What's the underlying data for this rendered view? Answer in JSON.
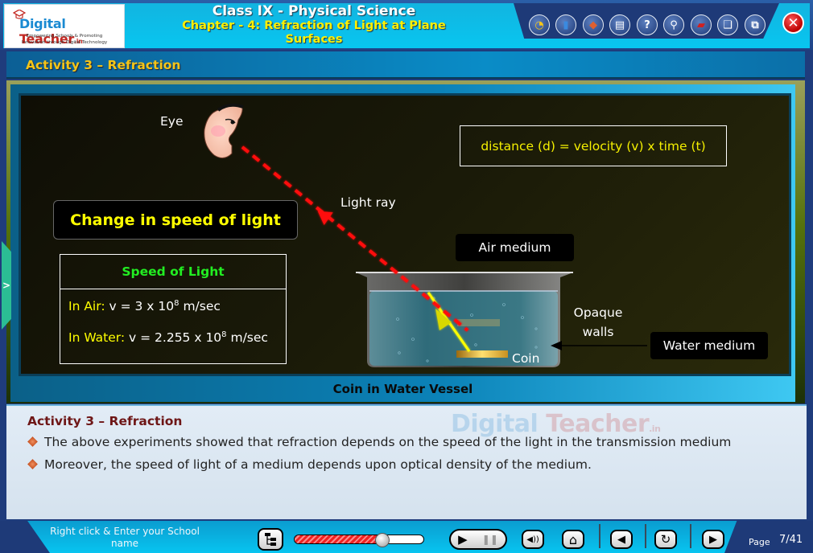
{
  "header": {
    "logo": {
      "brand_primary": "Digital",
      "brand_secondary": "Teacher",
      "brand_suffix": ".in",
      "tagline_line1": "Empowering Schools & Promoting",
      "tagline_line2": "Innovation through Digital Technology"
    },
    "title": "Class IX - Physical Science",
    "subtitle": "Chapter - 4: Refraction of Light at Plane Surfaces",
    "toolbar": [
      {
        "icon": "dashboard-folder-icon",
        "glyph": "◔"
      },
      {
        "icon": "reference-book-icon",
        "glyph": "▮"
      },
      {
        "icon": "drawing-board-icon",
        "glyph": "◆"
      },
      {
        "icon": "notepad-icon",
        "glyph": "▤"
      },
      {
        "icon": "help-icon",
        "glyph": "?"
      },
      {
        "icon": "search-zoom-icon",
        "glyph": "⚲"
      },
      {
        "icon": "pdf-book-icon",
        "glyph": "▰"
      },
      {
        "icon": "open-book-icon",
        "glyph": "❑"
      },
      {
        "icon": "window-resize-icon",
        "glyph": "⧉"
      }
    ],
    "close_glyph": "✕"
  },
  "activity": {
    "title": "Activity 3 – Refraction"
  },
  "stage": {
    "eye_label": "Eye",
    "light_ray_label": "Light ray",
    "formula": "distance (d) = velocity (v) x time (t)",
    "change_heading": "Change in speed of light",
    "speed_table": {
      "heading": "Speed of Light",
      "rows": [
        {
          "medium": "In Air:",
          "value_prefix": "v = 3 x 10",
          "exponent": "8",
          "unit": " m/sec"
        },
        {
          "medium": "In Water:",
          "value_prefix": "v = 2.255 x 10",
          "exponent": "8",
          "unit": " m/sec"
        }
      ]
    },
    "air_medium_label": "Air medium",
    "water_medium_label": "Water medium",
    "opaque_walls_line1": "Opaque",
    "opaque_walls_line2": "walls",
    "coin_label": "Coin",
    "caption": "Coin in Water Vessel",
    "side_tab_glyph": ">"
  },
  "panel": {
    "watermark_primary": "Digital",
    "watermark_secondary": "Teacher",
    "watermark_suffix": ".in",
    "title": "Activity 3 – Refraction",
    "bullets": [
      "The above experiments showed that refraction depends on the speed of the light in the transmission medium",
      "Moreover, the speed of light of a medium depends upon optical density of the medium."
    ]
  },
  "footer": {
    "school_name_prompt": "Right click & Enter your School name",
    "progress_percent": 68,
    "play_glyph": "▶",
    "pause_glyph": "❚❚",
    "sound_glyph": "◀))",
    "home_glyph": "⌂",
    "prev_glyph": "◀",
    "replay_glyph": "↻",
    "next_glyph": "▶",
    "page_label": "Page",
    "page_number": "7/41"
  }
}
